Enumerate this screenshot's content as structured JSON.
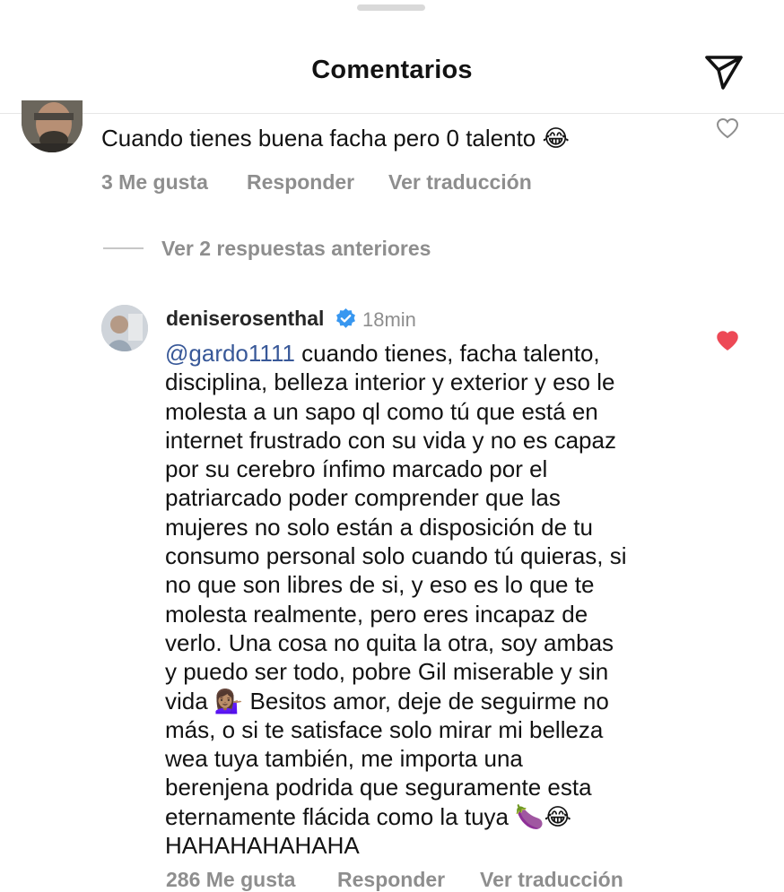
{
  "header": {
    "title": "Comentarios",
    "send_icon": "paper-plane-icon"
  },
  "comment1": {
    "text": "Cuando tienes buena facha pero 0 talento 😂",
    "likes": "3 Me gusta",
    "reply": "Responder",
    "translate": "Ver traducción"
  },
  "view_replies": "Ver 2 respuestas anteriores",
  "reply": {
    "username": "deniserosenthal",
    "time": "18min",
    "mention": "@gardo1111",
    "lines": [
      " cuando tienes, facha talento,",
      "disciplina, belleza interior y exterior y eso le",
      "molesta a un sapo ql como tú que está en",
      "internet frustrado con su vida y no es capaz",
      "por su cerebro ínfimo marcado por el",
      "patriarcado poder comprender que las",
      "mujeres no solo están a disposición de tu",
      "consumo personal solo cuando tú quieras, si",
      "no que son libres de si, y eso es lo que te",
      "molesta realmente, pero eres incapaz de",
      "verlo.  Una cosa no quita la otra, soy ambas",
      "y puedo ser todo, pobre Gil miserable y sin",
      "vida 💁🏽‍♀️ Besitos amor, deje de seguirme no",
      "más, o si te satisface solo mirar mi belleza",
      "wea tuya también, me importa una",
      "berenjena podrida que seguramente esta",
      "eternamente flácida como la tuya 🍆😂",
      "HAHAHAHAHAHA"
    ],
    "likes": "286 Me gusta",
    "reply_label": "Responder",
    "translate": "Ver traducción"
  },
  "colors": {
    "like_red": "#ed4956",
    "verified_blue": "#3897f0",
    "meta_gray": "#8e8e8e"
  }
}
